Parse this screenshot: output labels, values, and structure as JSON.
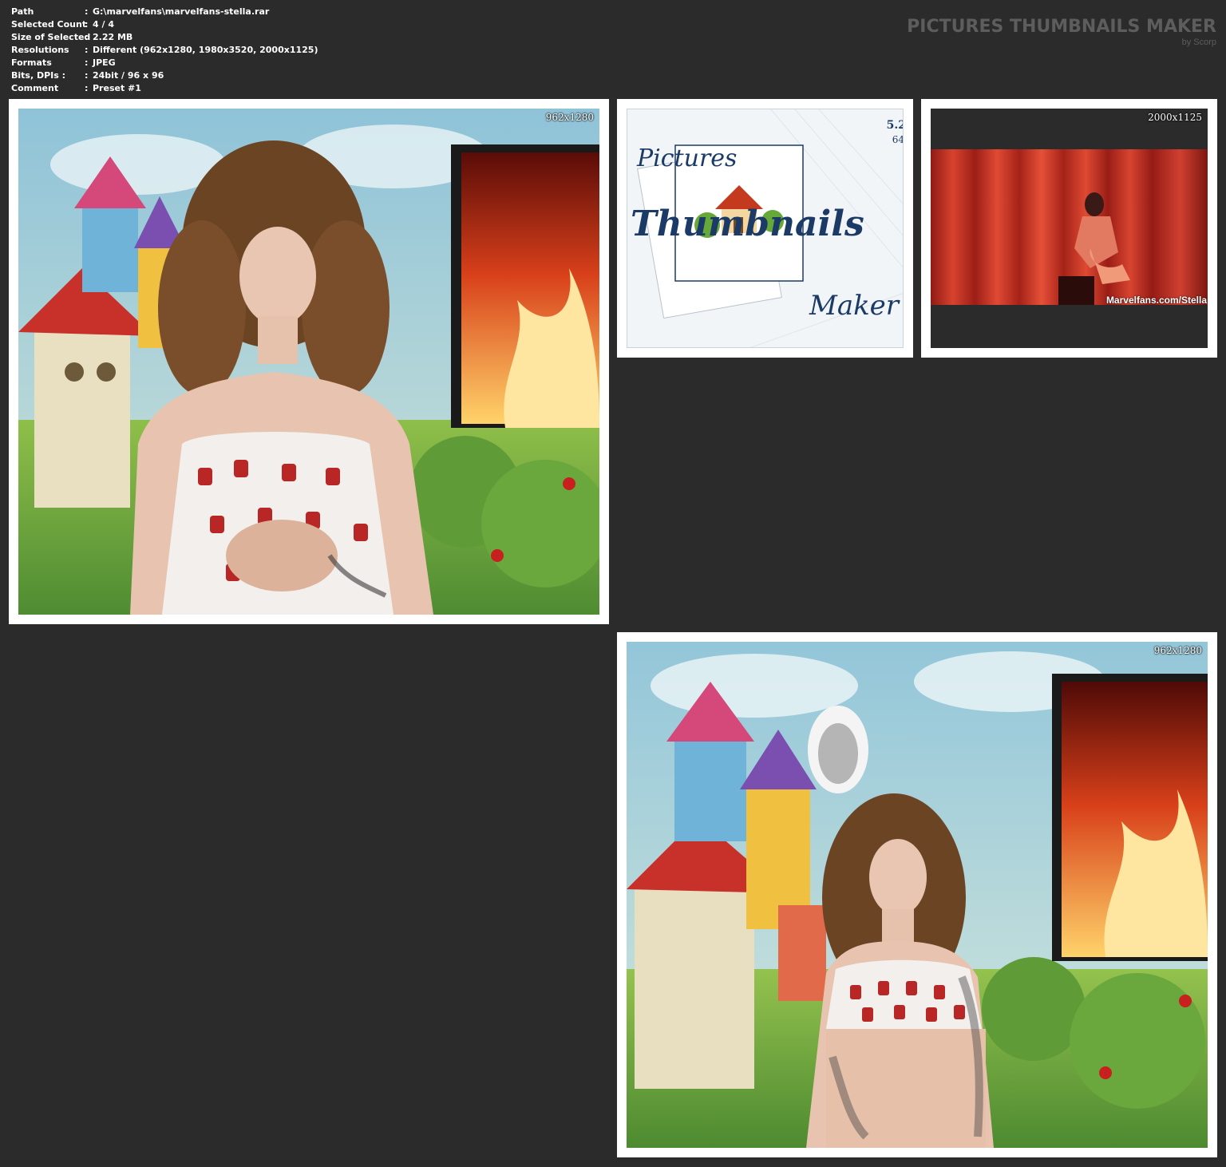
{
  "info": [
    {
      "key": "Path",
      "value": "G:\\marvelfans\\marvelfans-stella.rar"
    },
    {
      "key": "Selected Count",
      "value": "4 / 4"
    },
    {
      "key": "Size of Selected",
      "value": "2.22 MB"
    },
    {
      "key": "Resolutions",
      "value": "Different (962x1280, 1980x3520, 2000x1125)"
    },
    {
      "key": "Formats",
      "value": "JPEG"
    },
    {
      "key": "Bits, DPIs :",
      "value": "24bit / 96 x 96"
    },
    {
      "key": "Comment",
      "value": "Preset #1"
    }
  ],
  "separator": ":",
  "brand": {
    "title": "PICTURES THUMBNAILS MAKER",
    "subtitle": "by Scorp"
  },
  "thumbs": [
    {
      "resolution": "962x1280"
    },
    {
      "resolution": "",
      "logo_text": [
        "Pictures",
        "Thumbnails",
        "Maker"
      ],
      "version": "5.2",
      "bits": "64"
    },
    {
      "resolution": "2000x1125",
      "watermark": "Marvelfans.com/Stella"
    },
    {
      "resolution": "962x1280"
    }
  ]
}
